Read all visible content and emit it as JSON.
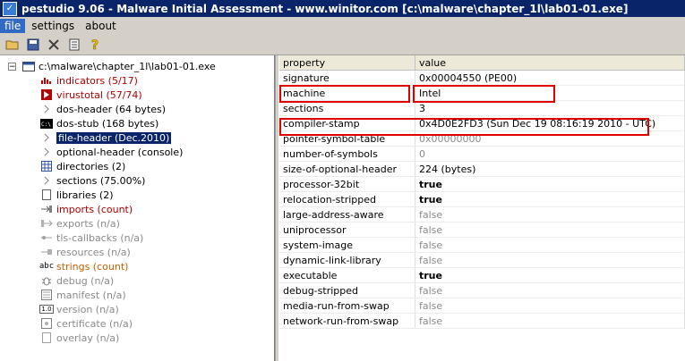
{
  "window": {
    "title": "pestudio 9.06 - Malware Initial Assessment - www.winitor.com [c:\\malware\\chapter_1l\\lab01-01.exe]"
  },
  "menu": [
    "file",
    "settings",
    "about"
  ],
  "toolbar": [
    "open-folder-icon",
    "save-icon",
    "cut-icon",
    "list-icon",
    "help-icon"
  ],
  "tree": {
    "root": "c:\\malware\\chapter_1l\\lab01-01.exe",
    "items": [
      {
        "label": "indicators (5/17)",
        "style": "red",
        "icon": "indicators-icon"
      },
      {
        "label": "virustotal (57/74)",
        "style": "red",
        "icon": "virustotal-icon"
      },
      {
        "label": "dos-header (64 bytes)",
        "style": "normal",
        "icon": "chevron-icon"
      },
      {
        "label": "dos-stub (168 bytes)",
        "style": "normal",
        "icon": "console-icon"
      },
      {
        "label": "file-header (Dec.2010)",
        "style": "selected",
        "icon": "chevron-icon"
      },
      {
        "label": "optional-header (console)",
        "style": "normal",
        "icon": "chevron-icon"
      },
      {
        "label": "directories (2)",
        "style": "normal",
        "icon": "grid-icon"
      },
      {
        "label": "sections (75.00%)",
        "style": "normal",
        "icon": "chevron-icon"
      },
      {
        "label": "libraries (2)",
        "style": "normal",
        "icon": "document-icon"
      },
      {
        "label": "imports (count)",
        "style": "red",
        "icon": "imports-icon"
      },
      {
        "label": "exports (n/a)",
        "style": "gray",
        "icon": "exports-icon"
      },
      {
        "label": "tls-callbacks (n/a)",
        "style": "gray",
        "icon": "tls-icon"
      },
      {
        "label": "resources (n/a)",
        "style": "gray",
        "icon": "resources-icon"
      },
      {
        "label": "strings (count)",
        "style": "orange",
        "icon": "abc-icon"
      },
      {
        "label": "debug (n/a)",
        "style": "gray",
        "icon": "bug-icon"
      },
      {
        "label": "manifest (n/a)",
        "style": "gray",
        "icon": "manifest-icon"
      },
      {
        "label": "version (n/a)",
        "style": "gray",
        "icon": "version-icon"
      },
      {
        "label": "certificate (n/a)",
        "style": "gray",
        "icon": "certificate-icon"
      },
      {
        "label": "overlay (n/a)",
        "style": "gray",
        "icon": "overlay-icon"
      }
    ]
  },
  "table": {
    "headers": [
      "property",
      "value"
    ],
    "rows": [
      {
        "property": "signature",
        "value": "0x00004550 (PE00)",
        "style": "normal"
      },
      {
        "property": "machine",
        "value": "Intel",
        "style": "normal"
      },
      {
        "property": "sections",
        "value": "3",
        "style": "normal"
      },
      {
        "property": "compiler-stamp",
        "value": "0x4D0E2FD3 (Sun Dec 19 08:16:19 2010 - UTC)",
        "style": "normal"
      },
      {
        "property": "pointer-symbol-table",
        "value": "0x00000000",
        "style": "gray"
      },
      {
        "property": "number-of-symbols",
        "value": "0",
        "style": "gray"
      },
      {
        "property": "size-of-optional-header",
        "value": "224 (bytes)",
        "style": "normal"
      },
      {
        "property": "processor-32bit",
        "value": "true",
        "style": "bold"
      },
      {
        "property": "relocation-stripped",
        "value": "true",
        "style": "bold"
      },
      {
        "property": "large-address-aware",
        "value": "false",
        "style": "gray"
      },
      {
        "property": "uniprocessor",
        "value": "false",
        "style": "gray"
      },
      {
        "property": "system-image",
        "value": "false",
        "style": "gray"
      },
      {
        "property": "dynamic-link-library",
        "value": "false",
        "style": "gray"
      },
      {
        "property": "executable",
        "value": "true",
        "style": "bold"
      },
      {
        "property": "debug-stripped",
        "value": "false",
        "style": "gray"
      },
      {
        "property": "media-run-from-swap",
        "value": "false",
        "style": "gray"
      },
      {
        "property": "network-run-from-swap",
        "value": "false",
        "style": "gray"
      }
    ]
  },
  "colors": {
    "title_bg": "#0a246a",
    "highlight_box": "#e00000",
    "alert_text": "#b00000",
    "strings_text": "#c06000",
    "disabled_text": "#8a8a8a"
  }
}
